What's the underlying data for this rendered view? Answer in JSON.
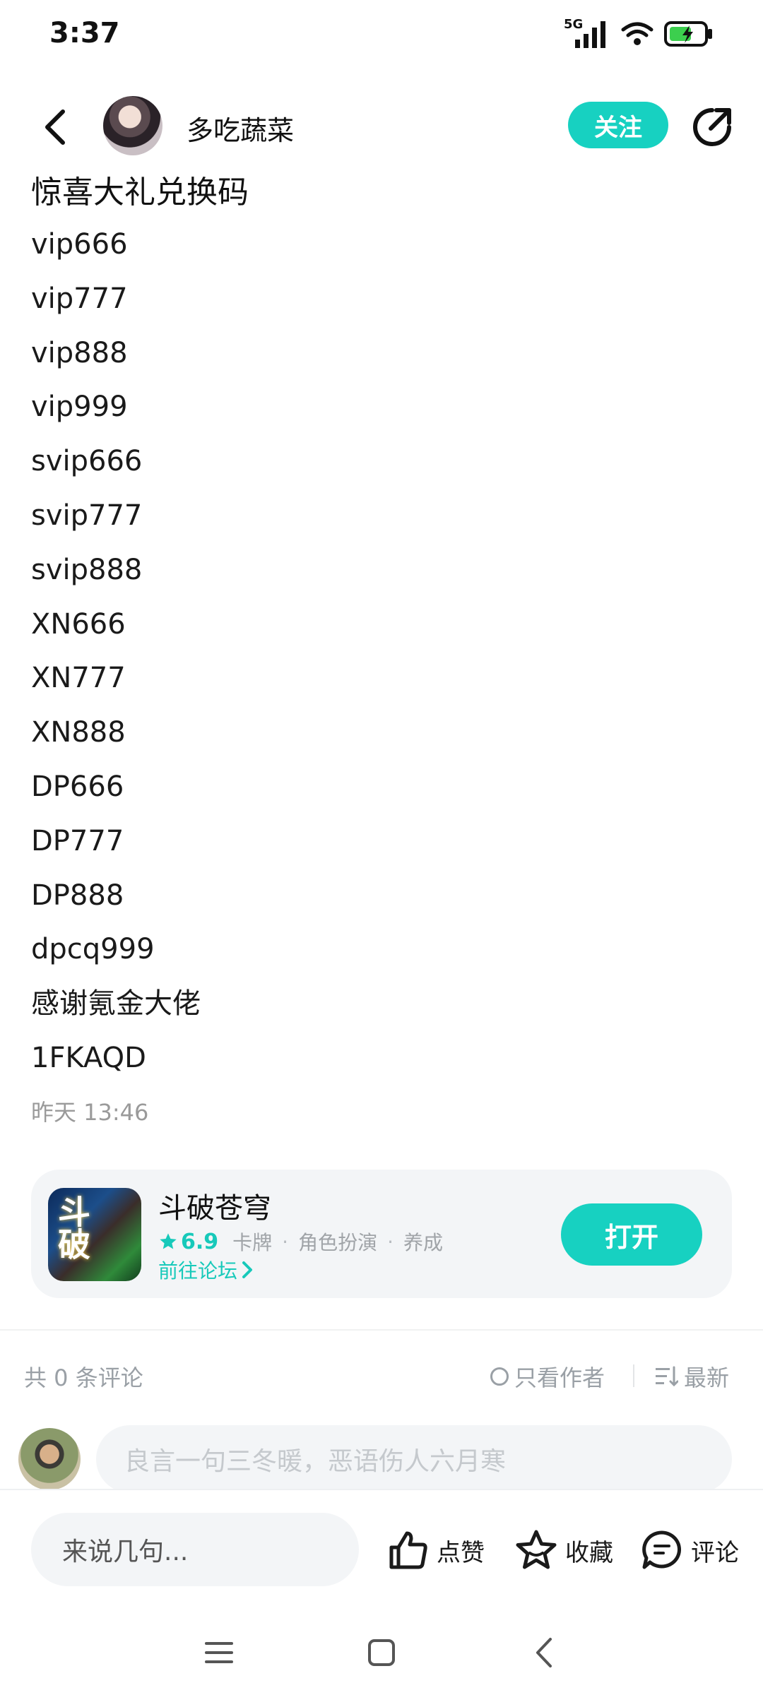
{
  "status_bar": {
    "time": "3:37",
    "network": "5G"
  },
  "header": {
    "author_name": "多吃蔬菜",
    "follow_label": "关注"
  },
  "post": {
    "title": "惊喜大礼兑换码",
    "lines": [
      "vip666",
      "vip777",
      "vip888",
      "vip999",
      "svip666",
      "svip777",
      "svip888",
      "XN666",
      "XN777",
      "XN888",
      "DP666",
      "DP777",
      "DP888",
      "dpcq999",
      "感谢氪金大佬",
      "1FKAQD"
    ],
    "time": "昨天 13:46"
  },
  "game_card": {
    "icon_text": "斗破",
    "name": "斗破苍穹",
    "rating": "6.9",
    "tags": [
      "卡牌",
      "角色扮演",
      "养成"
    ],
    "forum_link": "前往论坛",
    "open_label": "打开"
  },
  "comments": {
    "count_text": "共 0 条评论",
    "author_only_label": "只看作者",
    "sort_label": "最新",
    "input_placeholder": "良言一句三冬暖，恶语伤人六月寒"
  },
  "bottom_bar": {
    "say_placeholder": "来说几句...",
    "like_label": "点赞",
    "favorite_label": "收藏",
    "comment_label": "评论"
  },
  "colors": {
    "accent": "#17d1c1",
    "muted": "#9aa0a6"
  }
}
